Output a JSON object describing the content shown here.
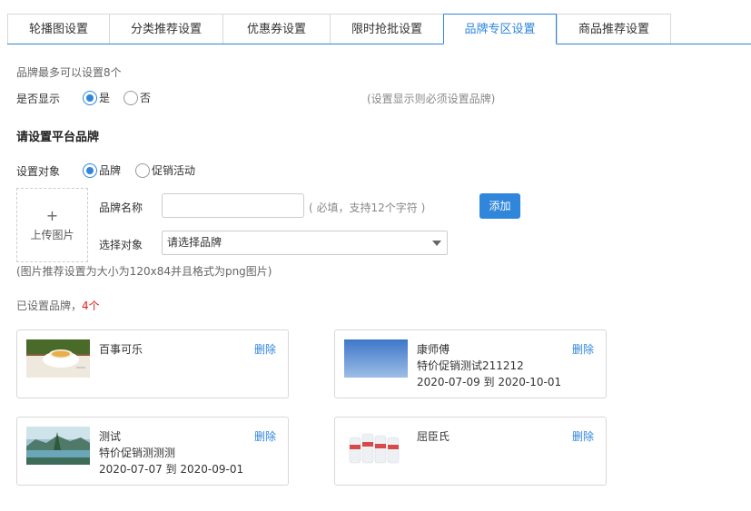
{
  "tabs": [
    {
      "label": "轮播图设置",
      "active": false
    },
    {
      "label": "分类推荐设置",
      "active": false
    },
    {
      "label": "优惠券设置",
      "active": false
    },
    {
      "label": "限时抢批设置",
      "active": false
    },
    {
      "label": "品牌专区设置",
      "active": true
    },
    {
      "label": "商品推荐设置",
      "active": false
    }
  ],
  "settings": {
    "max_note": "品牌最多可以设置8个",
    "show_label": "是否显示",
    "show_yes": "是",
    "show_no": "否",
    "show_selected": "yes",
    "show_hint": "(设置显示则必须设置品牌)"
  },
  "platform": {
    "title": "请设置平台品牌",
    "target_label": "设置对象",
    "target_brand": "品牌",
    "target_promo": "促销活动",
    "target_selected": "brand",
    "upload_label": "上传图片",
    "upload_plus": "+",
    "brand_name_label": "品牌名称",
    "brand_name_value": "",
    "brand_name_hint": "( 必填，支持12个字符 )",
    "add_button": "添加",
    "select_label": "选择对象",
    "select_value": "请选择品牌",
    "image_hint": "(图片推荐设置为大小为120x84并且格式为png图片)"
  },
  "configured": {
    "label": "已设置品牌，",
    "count": "4个"
  },
  "brands": [
    {
      "name": "百事可乐",
      "promo": "",
      "dates": "",
      "delete": "删除",
      "thumb": "coffee-photo"
    },
    {
      "name": "康师傅",
      "promo": "特价促销测试211212",
      "dates": "2020-07-09 到 2020-10-01",
      "delete": "删除",
      "thumb": "blue-sky-photo"
    },
    {
      "name": "测试",
      "promo": "特价促销测测测",
      "dates": "2020-07-07 到 2020-09-01",
      "delete": "删除",
      "thumb": "lake-photo"
    },
    {
      "name": "屈臣氏",
      "promo": "",
      "dates": "",
      "delete": "删除",
      "thumb": "water-bottles-photo"
    }
  ],
  "colors": {
    "accent": "#2f86db",
    "count_red": "#e02020"
  }
}
